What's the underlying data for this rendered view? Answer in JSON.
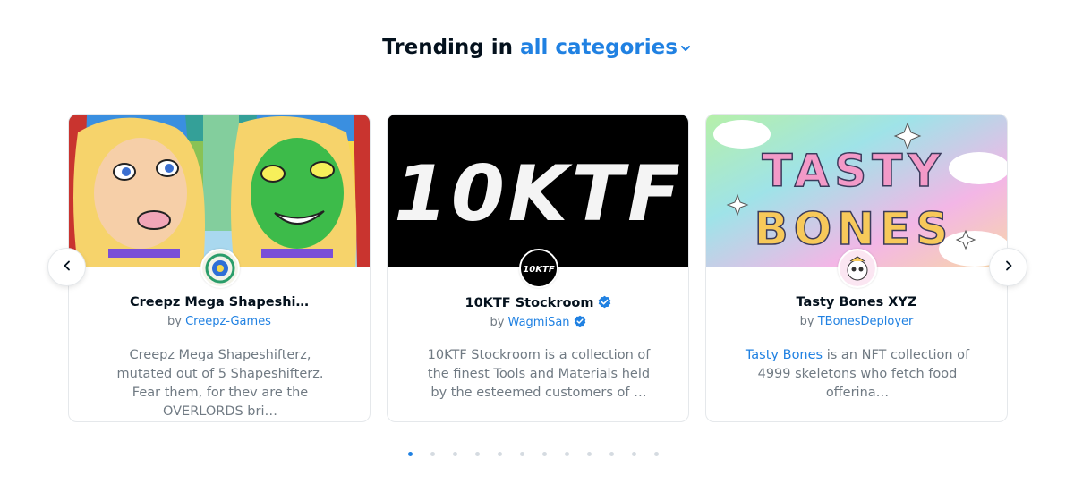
{
  "heading": {
    "prefix": "Trending in",
    "category": "all categories"
  },
  "cards": [
    {
      "name": "Creepz Mega Shapeshi…",
      "by_prefix": "by",
      "creator": "Creepz-Games",
      "description": "Creepz Mega Shapeshifterz, mutated out of 5 Shapeshifterz. Fear them, for thev are the OVERLORDS bri…"
    },
    {
      "name": "10KTF Stockroom",
      "by_prefix": "by",
      "creator": "WagmiSan",
      "description": "10KTF Stockroom is a collection of the finest Tools and Materials held by the esteemed customers of …",
      "banner_text": "10KTF",
      "logo_text": "10KTF"
    },
    {
      "name": "Tasty Bones XYZ",
      "by_prefix": "by",
      "creator": "TBonesDeployer",
      "description_link": "Tasty Bones",
      "description": " is an NFT collection of 4999 skeletons who fetch food offerina…",
      "banner_line1": "TASTY",
      "banner_line2": "BONES"
    }
  ],
  "carousel": {
    "page_count": 12,
    "active_index": 0
  },
  "colors": {
    "accent": "#2081e2",
    "text_dark": "#04111d",
    "text_muted": "#707a83",
    "border": "#e5e8eb"
  },
  "icons": {
    "prev": "chevron-left-icon",
    "next": "chevron-right-icon",
    "verified": "verified-badge-icon",
    "dropdown": "chevron-down-icon"
  }
}
